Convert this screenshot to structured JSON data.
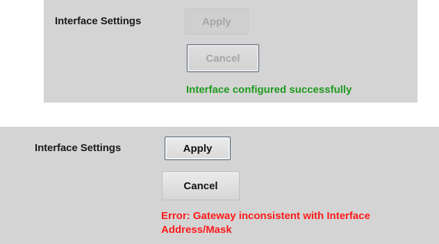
{
  "top_panel": {
    "label": "Interface Settings",
    "apply_label": "Apply",
    "cancel_label": "Cancel",
    "status_message": "Interface configured successfully",
    "status_color": "#1e9a1e"
  },
  "bottom_panel": {
    "label": "Interface Settings",
    "apply_label": "Apply",
    "cancel_label": "Cancel",
    "status_message": "Error: Gateway inconsistent with Interface Address/Mask",
    "status_color": "#ff1a1a"
  }
}
